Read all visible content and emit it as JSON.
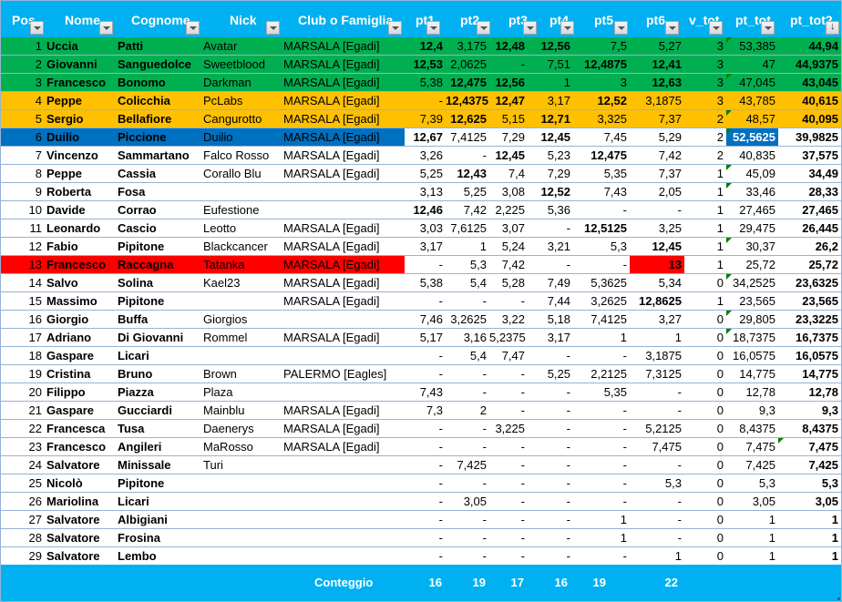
{
  "columns": [
    {
      "key": "pos",
      "label": "Pos"
    },
    {
      "key": "nome",
      "label": "Nome"
    },
    {
      "key": "cognome",
      "label": "Cognome"
    },
    {
      "key": "nick",
      "label": "Nick"
    },
    {
      "key": "club",
      "label": "Club o Famiglia"
    },
    {
      "key": "pt1",
      "label": "pt1"
    },
    {
      "key": "pt2",
      "label": "pt2"
    },
    {
      "key": "pt3",
      "label": "pt3"
    },
    {
      "key": "pt4",
      "label": "pt4"
    },
    {
      "key": "pt5",
      "label": "pt5"
    },
    {
      "key": "pt6",
      "label": "pt6"
    },
    {
      "key": "v_tot",
      "label": "v_tot"
    },
    {
      "key": "pt_tot",
      "label": "pt_tot"
    },
    {
      "key": "pt_tot2",
      "label": "pt_tot2",
      "sorted": "descending"
    }
  ],
  "colors": {
    "header": "#00b0f0",
    "top3": "#00b050",
    "places_4_5": "#ffc000",
    "highlight_blue": "#0070c0",
    "highlight_red": "#ff0000",
    "grid": "#95b3d7",
    "comment_marker": "#008000"
  },
  "rows": [
    {
      "pos": "1",
      "nome": "Uccia",
      "cognome": "Patti",
      "nick": "Avatar",
      "club": "MARSALA [Egadi]",
      "pt1": "12,4",
      "pt2": "3,175",
      "pt3": "12,48",
      "pt4": "12,56",
      "pt5": "7,5",
      "pt6": "5,27",
      "v_tot": "3",
      "pt_tot": "53,385",
      "pt_tot2": "44,94",
      "bold": [
        "pt1",
        "pt3",
        "pt4"
      ],
      "fill": "green",
      "marker": "pt_tot"
    },
    {
      "pos": "2",
      "nome": "Giovanni",
      "cognome": "Sanguedolce",
      "nick": "Sweetblood",
      "club": "MARSALA [Egadi]",
      "pt1": "12,53",
      "pt2": "2,0625",
      "pt3": "-",
      "pt4": "7,51",
      "pt5": "12,4875",
      "pt6": "12,41",
      "v_tot": "3",
      "pt_tot": "47",
      "pt_tot2": "44,9375",
      "bold": [
        "pt1",
        "pt5",
        "pt6"
      ],
      "fill": "green"
    },
    {
      "pos": "3",
      "nome": "Francesco",
      "cognome": "Bonomo",
      "nick": "Darkman",
      "club": "MARSALA [Egadi]",
      "pt1": "5,38",
      "pt2": "12,475",
      "pt3": "12,56",
      "pt4": "1",
      "pt5": "3",
      "pt6": "12,63",
      "v_tot": "3",
      "pt_tot": "47,045",
      "pt_tot2": "43,045",
      "bold": [
        "pt2",
        "pt3",
        "pt6"
      ],
      "fill": "green",
      "marker": "pt_tot"
    },
    {
      "pos": "4",
      "nome": "Peppe",
      "cognome": "Colicchia",
      "nick": "PcLabs",
      "club": "MARSALA [Egadi]",
      "pt1": "-",
      "pt2": "12,4375",
      "pt3": "12,47",
      "pt4": "3,17",
      "pt5": "12,52",
      "pt6": "3,1875",
      "v_tot": "3",
      "pt_tot": "43,785",
      "pt_tot2": "40,615",
      "bold": [
        "pt2",
        "pt3",
        "pt5"
      ],
      "fill": "orange"
    },
    {
      "pos": "5",
      "nome": "Sergio",
      "cognome": "Bellafiore",
      "nick": "Cangurotto",
      "club": "MARSALA [Egadi]",
      "pt1": "7,39",
      "pt2": "12,625",
      "pt3": "5,15",
      "pt4": "12,71",
      "pt5": "3,325",
      "pt6": "7,37",
      "v_tot": "2",
      "pt_tot": "48,57",
      "pt_tot2": "40,095",
      "bold": [
        "pt2",
        "pt4"
      ],
      "fill": "orange",
      "marker": "pt_tot"
    },
    {
      "pos": "6",
      "nome": "Duilio",
      "cognome": "Piccione",
      "nick": "Duilio",
      "club": "MARSALA [Egadi]",
      "pt1": "12,67",
      "pt2": "7,4125",
      "pt3": "7,29",
      "pt4": "12,45",
      "pt5": "7,45",
      "pt6": "5,29",
      "v_tot": "2",
      "pt_tot": "52,5625",
      "pt_tot2": "39,9825",
      "bold": [
        "pt1",
        "pt4",
        "pt_tot"
      ],
      "fill": "blue-left",
      "cellfill": {
        "pt_tot": "blue"
      },
      "marker": "pt_tot"
    },
    {
      "pos": "7",
      "nome": "Vincenzo",
      "cognome": "Sammartano",
      "nick": "Falco Rosso",
      "club": "MARSALA [Egadi]",
      "pt1": "3,26",
      "pt2": "-",
      "pt3": "12,45",
      "pt4": "5,23",
      "pt5": "12,475",
      "pt6": "7,42",
      "v_tot": "2",
      "pt_tot": "40,835",
      "pt_tot2": "37,575",
      "bold": [
        "pt3",
        "pt5"
      ]
    },
    {
      "pos": "8",
      "nome": "Peppe",
      "cognome": "Cassia",
      "nick": "Corallo Blu",
      "club": "MARSALA [Egadi]",
      "pt1": "5,25",
      "pt2": "12,43",
      "pt3": "7,4",
      "pt4": "7,29",
      "pt5": "5,35",
      "pt6": "7,37",
      "v_tot": "1",
      "pt_tot": "45,09",
      "pt_tot2": "34,49",
      "bold": [
        "pt2"
      ],
      "marker": "pt_tot"
    },
    {
      "pos": "9",
      "nome": "Roberta",
      "cognome": "Fosa",
      "nick": "",
      "club": "",
      "pt1": "3,13",
      "pt2": "5,25",
      "pt3": "3,08",
      "pt4": "12,52",
      "pt5": "7,43",
      "pt6": "2,05",
      "v_tot": "1",
      "pt_tot": "33,46",
      "pt_tot2": "28,33",
      "bold": [
        "pt4"
      ],
      "marker": "pt_tot"
    },
    {
      "pos": "10",
      "nome": "Davide",
      "cognome": "Corrao",
      "nick": "Eufestione",
      "club": "",
      "pt1": "12,46",
      "pt2": "7,42",
      "pt3": "2,225",
      "pt4": "5,36",
      "pt5": "-",
      "pt6": "-",
      "v_tot": "1",
      "pt_tot": "27,465",
      "pt_tot2": "27,465",
      "bold": [
        "pt1"
      ]
    },
    {
      "pos": "11",
      "nome": "Leonardo",
      "cognome": "Cascio",
      "nick": "Leotto",
      "club": "MARSALA [Egadi]",
      "pt1": "3,03",
      "pt2": "7,6125",
      "pt3": "3,07",
      "pt4": "-",
      "pt5": "12,5125",
      "pt6": "3,25",
      "v_tot": "1",
      "pt_tot": "29,475",
      "pt_tot2": "26,445",
      "bold": [
        "pt5"
      ]
    },
    {
      "pos": "12",
      "nome": "Fabio",
      "cognome": "Pipitone",
      "nick": "Blackcancer",
      "club": "MARSALA [Egadi]",
      "pt1": "3,17",
      "pt2": "1",
      "pt3": "5,24",
      "pt4": "3,21",
      "pt5": "5,3",
      "pt6": "12,45",
      "v_tot": "1",
      "pt_tot": "30,37",
      "pt_tot2": "26,2",
      "bold": [
        "pt6"
      ],
      "marker": "pt_tot"
    },
    {
      "pos": "13",
      "nome": "Francesco",
      "cognome": "Raccagna",
      "nick": "Tatanka",
      "club": "MARSALA [Egadi]",
      "pt1": "-",
      "pt2": "5,3",
      "pt3": "7,42",
      "pt4": "-",
      "pt5": "-",
      "pt6": "13",
      "v_tot": "1",
      "pt_tot": "25,72",
      "pt_tot2": "25,72",
      "bold": [
        "pt6"
      ],
      "fill": "red-left",
      "cellfill": {
        "pt6": "red"
      }
    },
    {
      "pos": "14",
      "nome": "Salvo",
      "cognome": "Solina",
      "nick": "Kael23",
      "club": "MARSALA [Egadi]",
      "pt1": "5,38",
      "pt2": "5,4",
      "pt3": "5,28",
      "pt4": "7,49",
      "pt5": "5,3625",
      "pt6": "5,34",
      "v_tot": "0",
      "pt_tot": "34,2525",
      "pt_tot2": "23,6325",
      "bold": [],
      "marker": "pt_tot"
    },
    {
      "pos": "15",
      "nome": "Massimo",
      "cognome": "Pipitone",
      "nick": "",
      "club": "MARSALA [Egadi]",
      "pt1": "-",
      "pt2": "-",
      "pt3": "-",
      "pt4": "7,44",
      "pt5": "3,2625",
      "pt6": "12,8625",
      "v_tot": "1",
      "pt_tot": "23,565",
      "pt_tot2": "23,565",
      "bold": [
        "pt6"
      ]
    },
    {
      "pos": "16",
      "nome": "Giorgio",
      "cognome": "Buffa",
      "nick": "Giorgios",
      "club": "",
      "pt1": "7,46",
      "pt2": "3,2625",
      "pt3": "3,22",
      "pt4": "5,18",
      "pt5": "7,4125",
      "pt6": "3,27",
      "v_tot": "0",
      "pt_tot": "29,805",
      "pt_tot2": "23,3225",
      "bold": [],
      "marker": "pt_tot"
    },
    {
      "pos": "17",
      "nome": "Adriano",
      "cognome": "Di Giovanni",
      "nick": "Rommel",
      "club": "MARSALA [Egadi]",
      "pt1": "5,17",
      "pt2": "3,16",
      "pt3": "5,2375",
      "pt4": "3,17",
      "pt5": "1",
      "pt6": "1",
      "v_tot": "0",
      "pt_tot": "18,7375",
      "pt_tot2": "16,7375",
      "bold": [],
      "marker": "pt_tot"
    },
    {
      "pos": "18",
      "nome": "Gaspare",
      "cognome": "Licari",
      "nick": "",
      "club": "",
      "pt1": "-",
      "pt2": "5,4",
      "pt3": "7,47",
      "pt4": "-",
      "pt5": "-",
      "pt6": "3,1875",
      "v_tot": "0",
      "pt_tot": "16,0575",
      "pt_tot2": "16,0575",
      "bold": []
    },
    {
      "pos": "19",
      "nome": "Cristina",
      "cognome": "Bruno",
      "nick": "Brown",
      "club": "PALERMO [Eagles]",
      "pt1": "-",
      "pt2": "-",
      "pt3": "-",
      "pt4": "5,25",
      "pt5": "2,2125",
      "pt6": "7,3125",
      "v_tot": "0",
      "pt_tot": "14,775",
      "pt_tot2": "14,775",
      "bold": []
    },
    {
      "pos": "20",
      "nome": "Filippo",
      "cognome": "Piazza",
      "nick": "Plaza",
      "club": "",
      "pt1": "7,43",
      "pt2": "-",
      "pt3": "-",
      "pt4": "-",
      "pt5": "5,35",
      "pt6": "-",
      "v_tot": "0",
      "pt_tot": "12,78",
      "pt_tot2": "12,78",
      "bold": []
    },
    {
      "pos": "21",
      "nome": "Gaspare",
      "cognome": "Gucciardi",
      "nick": "Mainblu",
      "club": "MARSALA [Egadi]",
      "pt1": "7,3",
      "pt2": "2",
      "pt3": "-",
      "pt4": "-",
      "pt5": "-",
      "pt6": "-",
      "v_tot": "0",
      "pt_tot": "9,3",
      "pt_tot2": "9,3",
      "bold": []
    },
    {
      "pos": "22",
      "nome": "Francesca",
      "cognome": "Tusa",
      "nick": "Daenerys",
      "club": "MARSALA [Egadi]",
      "pt1": "-",
      "pt2": "-",
      "pt3": "3,225",
      "pt4": "-",
      "pt5": "-",
      "pt6": "5,2125",
      "v_tot": "0",
      "pt_tot": "8,4375",
      "pt_tot2": "8,4375",
      "bold": []
    },
    {
      "pos": "23",
      "nome": "Francesco",
      "cognome": "Angileri",
      "nick": "MaRosso",
      "club": "MARSALA [Egadi]",
      "pt1": "-",
      "pt2": "-",
      "pt3": "-",
      "pt4": "-",
      "pt5": "-",
      "pt6": "7,475",
      "v_tot": "0",
      "pt_tot": "7,475",
      "pt_tot2": "7,475",
      "bold": [],
      "marker": "pt_tot2"
    },
    {
      "pos": "24",
      "nome": "Salvatore",
      "cognome": "Minissale",
      "nick": "Turi",
      "club": "",
      "pt1": "-",
      "pt2": "7,425",
      "pt3": "-",
      "pt4": "-",
      "pt5": "-",
      "pt6": "-",
      "v_tot": "0",
      "pt_tot": "7,425",
      "pt_tot2": "7,425",
      "bold": []
    },
    {
      "pos": "25",
      "nome": "Nicolò",
      "cognome": "Pipitone",
      "nick": "",
      "club": "",
      "pt1": "-",
      "pt2": "-",
      "pt3": "-",
      "pt4": "-",
      "pt5": "-",
      "pt6": "5,3",
      "v_tot": "0",
      "pt_tot": "5,3",
      "pt_tot2": "5,3",
      "bold": []
    },
    {
      "pos": "26",
      "nome": "Mariolina",
      "cognome": "Licari",
      "nick": "",
      "club": "",
      "pt1": "-",
      "pt2": "3,05",
      "pt3": "-",
      "pt4": "-",
      "pt5": "-",
      "pt6": "-",
      "v_tot": "0",
      "pt_tot": "3,05",
      "pt_tot2": "3,05",
      "bold": []
    },
    {
      "pos": "27",
      "nome": "Salvatore",
      "cognome": "Albigiani",
      "nick": "",
      "club": "",
      "pt1": "-",
      "pt2": "-",
      "pt3": "-",
      "pt4": "-",
      "pt5": "1",
      "pt6": "-",
      "v_tot": "0",
      "pt_tot": "1",
      "pt_tot2": "1",
      "bold": []
    },
    {
      "pos": "28",
      "nome": "Salvatore",
      "cognome": "Frosina",
      "nick": "",
      "club": "",
      "pt1": "-",
      "pt2": "-",
      "pt3": "-",
      "pt4": "-",
      "pt5": "1",
      "pt6": "-",
      "v_tot": "0",
      "pt_tot": "1",
      "pt_tot2": "1",
      "bold": []
    },
    {
      "pos": "29",
      "nome": "Salvatore",
      "cognome": "Lembo",
      "nick": "",
      "club": "",
      "pt1": "-",
      "pt2": "-",
      "pt3": "-",
      "pt4": "-",
      "pt5": "-",
      "pt6": "1",
      "v_tot": "0",
      "pt_tot": "1",
      "pt_tot2": "1",
      "bold": []
    }
  ],
  "footer": {
    "label": "Conteggio",
    "pt1": "16",
    "pt2": "19",
    "pt3": "17",
    "pt4": "16",
    "pt5": "19",
    "pt6": "22"
  }
}
